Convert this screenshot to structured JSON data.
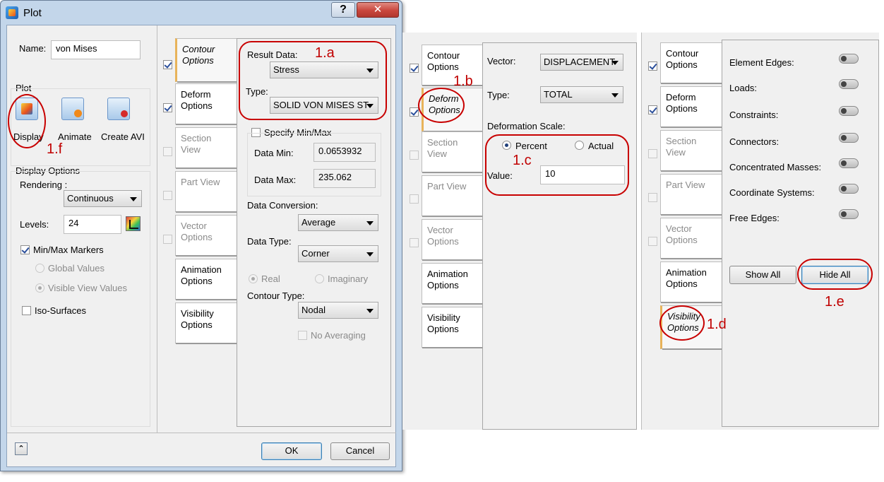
{
  "window": {
    "title": "Plot",
    "help_glyph": "?",
    "close_glyph": "✕"
  },
  "name": {
    "label": "Name:",
    "value": "von Mises"
  },
  "plot": {
    "group_label": "Plot",
    "buttons": [
      {
        "label": "Display"
      },
      {
        "label": "Animate"
      },
      {
        "label": "Create AVI"
      }
    ]
  },
  "display_options": {
    "group_label": "Display Options",
    "rendering_label": "Rendering :",
    "rendering_value": "Continuous",
    "levels_label": "Levels:",
    "levels_value": "24",
    "minmax_label": "Min/Max Markers",
    "global_values_label": "Global Values",
    "visible_view_label": "Visible View Values",
    "iso_label": "Iso-Surfaces"
  },
  "tabs": [
    {
      "label_1": "Contour",
      "label_2": "Options"
    },
    {
      "label_1": "Deform",
      "label_2": "Options"
    },
    {
      "label_1": "Section View",
      "label_2": ""
    },
    {
      "label_1": "Part View",
      "label_2": ""
    },
    {
      "label_1": "Vector",
      "label_2": "Options"
    },
    {
      "label_1": "Animation",
      "label_2": "Options"
    },
    {
      "label_1": "Visibility",
      "label_2": "Options"
    }
  ],
  "contour": {
    "result_data_label": "Result Data:",
    "result_data_value": "Stress",
    "type_label": "Type:",
    "type_value": "SOLID VON MISES ST",
    "specify_label": "Specify Min/Max",
    "data_min_label": "Data Min:",
    "data_min_value": "0.0653932",
    "data_max_label": "Data Max:",
    "data_max_value": "235.062",
    "conversion_label": "Data Conversion:",
    "conversion_value": "Average",
    "data_type_label": "Data Type:",
    "data_type_value": "Corner",
    "real_label": "Real",
    "imaginary_label": "Imaginary",
    "contour_type_label": "Contour Type:",
    "contour_type_value": "Nodal",
    "no_avg_label": "No Averaging"
  },
  "footer": {
    "expand_glyph": "⌃",
    "ok_label": "OK",
    "cancel_label": "Cancel"
  },
  "deform": {
    "vector_label": "Vector:",
    "vector_value": "DISPLACEMENT",
    "type_label": "Type:",
    "type_value": "TOTAL",
    "scale_label": "Deformation Scale:",
    "percent_label": "Percent",
    "actual_label": "Actual",
    "value_label": "Value:",
    "value_value": "10"
  },
  "visibility": {
    "items": [
      "Element Edges:",
      "Loads:",
      "Constraints:",
      "Connectors:",
      "Concentrated Masses:",
      "Coordinate Systems:",
      "Free Edges:"
    ],
    "show_all_label": "Show All",
    "hide_all_label": "Hide All"
  },
  "annotations": {
    "a": "1.a",
    "b": "1.b",
    "c": "1.c",
    "d": "1.d",
    "e": "1.e",
    "f": "1.f"
  },
  "colors": {
    "annotation": "#c80000",
    "selected_tab_accent": "#e8b35a",
    "titlebar": "#c3d6ea",
    "close_button": "#c9463d"
  }
}
